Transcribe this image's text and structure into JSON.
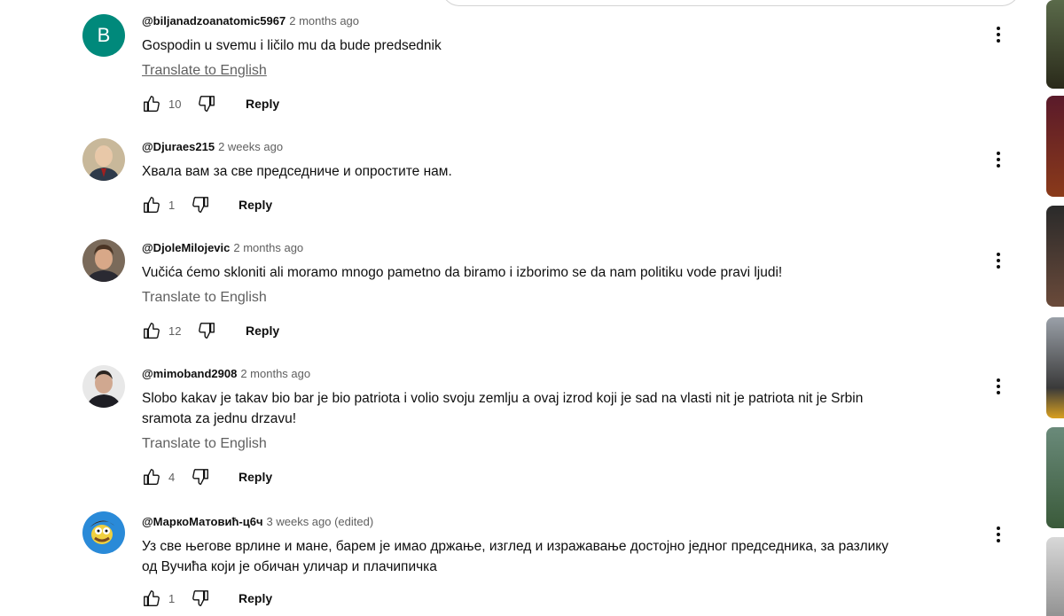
{
  "comments": [
    {
      "author": "@biljanadzoanatomic5967",
      "time": "2 months ago",
      "avatar_letter": "B",
      "text": "Gospodin u svemu i ličilo mu da bude predsednik",
      "translate": "Translate to English",
      "likes": "10",
      "reply": "Reply"
    },
    {
      "author": "@Djuraes215",
      "time": "2 weeks ago",
      "text": "Хвала вам за све председниче и опростите нам.",
      "likes": "1",
      "reply": "Reply"
    },
    {
      "author": "@DjoleMilojevic",
      "time": "2 months ago",
      "text": "Vučića ćemo skloniti ali moramo mnogo pametno da biramo i izborimo se da nam politiku vode pravi ljudi!",
      "translate": "Translate to English",
      "likes": "12",
      "reply": "Reply"
    },
    {
      "author": "@mimoband2908",
      "time": "2 months ago",
      "text_line1": "Slobo kakav je takav bio bar je bio patriota i volio svoju zemlju a ovaj izrod koji je sad na vlasti nit je patriota nit je Srbin",
      "text_line2": "sramota za jednu drzavu!",
      "translate": "Translate to English",
      "likes": "4",
      "reply": "Reply"
    },
    {
      "author": "@МаркоМатовић-ц6ч",
      "time": "3 weeks ago (edited)",
      "text_line1": "Уз све његове врлине и мане, барем је имао држање, изглед и изражавање достојно једног председника, за разлику",
      "text_line2": "од Вучића који је обичан уличар и плачипичка",
      "likes": "1",
      "reply": "Reply"
    }
  ],
  "colors": {
    "text_primary": "#0f0f0f",
    "text_secondary": "#606060",
    "avatar_b": "#00897b",
    "background": "#ffffff"
  },
  "icons": {
    "like": "thumb-up-icon",
    "dislike": "thumb-down-icon",
    "menu": "more-vert-icon"
  }
}
